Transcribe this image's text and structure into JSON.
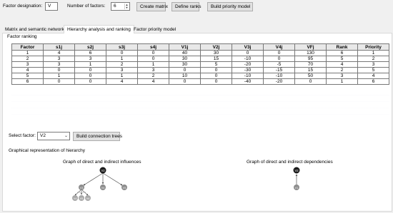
{
  "toolbar": {
    "designation_label": "Factor designation:",
    "designation_value": "V",
    "factors_label": "Number of factors:",
    "factors_value": "6",
    "create_matrix": "Create matrix",
    "define_ranks": "Define ranks",
    "build_model": "Build priority model"
  },
  "tabs": [
    "Matrix and semantic network",
    "Hierarchy analysis and ranking",
    "Factor priority model"
  ],
  "ranking": {
    "title": "Factor ranking",
    "headers": [
      "Factor",
      "s1j",
      "s2j",
      "s3j",
      "s4j",
      "V1j",
      "V2j",
      "V3j",
      "V4j",
      "VFj",
      "Rank",
      "Priority"
    ],
    "rows": [
      [
        "1",
        "4",
        "6",
        "0",
        "0",
        "40",
        "30",
        "0",
        "0",
        "130",
        "6",
        "1"
      ],
      [
        "2",
        "3",
        "3",
        "1",
        "0",
        "30",
        "15",
        "-10",
        "0",
        "95",
        "5",
        "2"
      ],
      [
        "3",
        "3",
        "1",
        "2",
        "1",
        "30",
        "5",
        "-20",
        "-5",
        "70",
        "4",
        "3"
      ],
      [
        "4",
        "0",
        "0",
        "3",
        "3",
        "0",
        "0",
        "-30",
        "-15",
        "15",
        "2",
        "5"
      ],
      [
        "5",
        "1",
        "0",
        "1",
        "2",
        "10",
        "0",
        "-10",
        "-10",
        "50",
        "3",
        "4"
      ],
      [
        "6",
        "0",
        "0",
        "4",
        "4",
        "0",
        "0",
        "-40",
        "-20",
        "0",
        "1",
        "6"
      ]
    ]
  },
  "select_factor": {
    "label": "Select factor:",
    "value": "V2",
    "build_trees": "Build connection trees"
  },
  "graph_section": {
    "title": "Graphical representation of hierarchy",
    "left_title": "Graph of direct and indirect influences",
    "right_title": "Graph of direct and indirect dependencies",
    "left_nodes": {
      "root": "V2",
      "level1": [
        "V3",
        "V4",
        "V5"
      ],
      "level2": [
        "V4",
        "V5",
        "V6"
      ]
    },
    "right_nodes": {
      "top": "V2",
      "bottom": "V1"
    },
    "root_color": "#1a1a1a",
    "node_color": "#8c8c8c",
    "edge_color": "#555555"
  }
}
